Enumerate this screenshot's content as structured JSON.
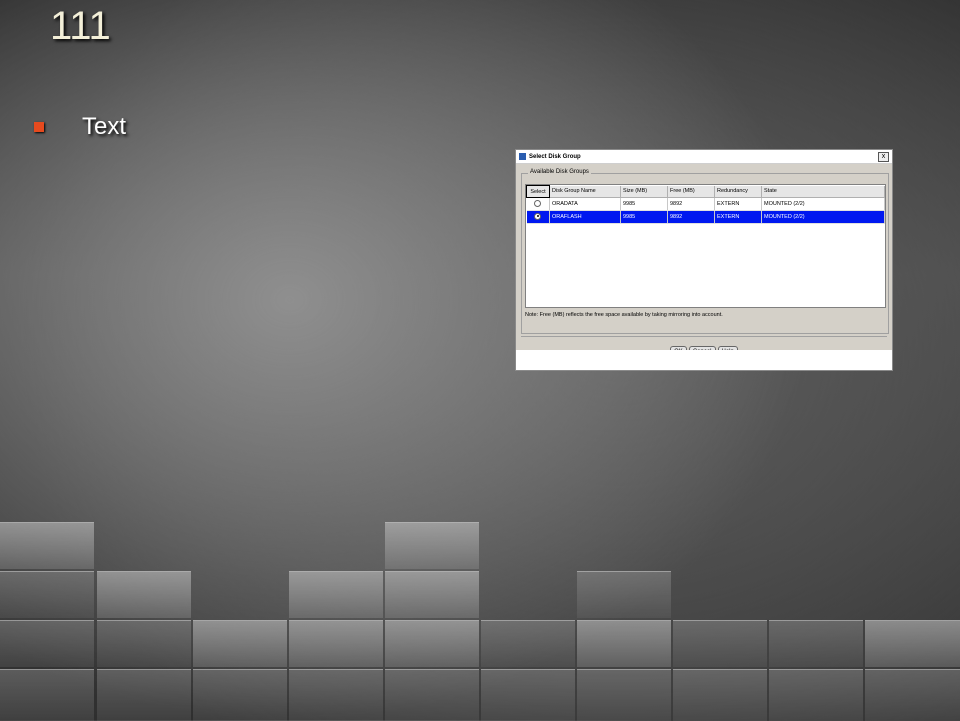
{
  "slide": {
    "title": "111",
    "bullets": [
      "Text"
    ],
    "bullet_color": "#e64a1e"
  },
  "dialog": {
    "title": "Select Disk Group",
    "close_label": "x",
    "group_label": "Available Disk Groups",
    "columns": [
      "Select",
      "Disk Group Name",
      "Size (MB)",
      "Free (MB)",
      "Redundancy",
      "State"
    ],
    "rows": [
      {
        "selected": false,
        "name": "ORADATA",
        "size": "9985",
        "free": "9892",
        "redundancy": "EXTERN",
        "state": "MOUNTED (2/2)"
      },
      {
        "selected": true,
        "name": "ORAFLASH",
        "size": "9985",
        "free": "9892",
        "redundancy": "EXTERN",
        "state": "MOUNTED (2/2)"
      }
    ],
    "note": "Note: Free (MB) reflects the free space available by taking mirroring into account.",
    "buttons": {
      "ok": "OK",
      "cancel": "Cancel",
      "help": "Help"
    },
    "selection_color": "#0018f0"
  }
}
